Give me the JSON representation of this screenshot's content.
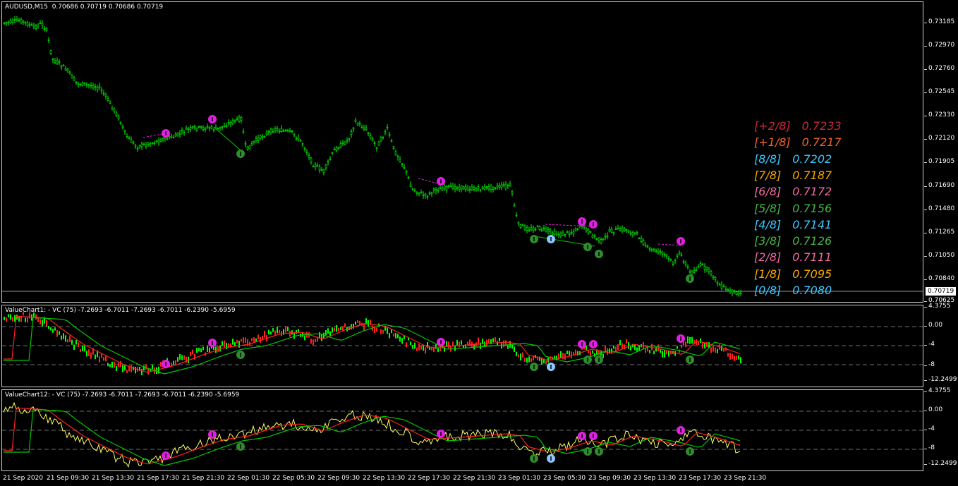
{
  "main": {
    "title": "AUDUSD,M15  0.70686 0.70719 0.70686 0.70719",
    "current_price": "0.70719",
    "price_ticks": [
      "0.73185",
      "0.72970",
      "0.72760",
      "0.72545",
      "0.72330",
      "0.72120",
      "0.71905",
      "0.71690",
      "0.71480",
      "0.71265",
      "0.71050",
      "0.70840",
      "0.70625"
    ],
    "murrey_levels": [
      {
        "label": "[+2/8]",
        "value": "0.7233",
        "color": "#c8283c"
      },
      {
        "label": "[+1/8]",
        "value": "0.7217",
        "color": "#f06428"
      },
      {
        "label": "[8/8]",
        "value": "0.7202",
        "color": "#3cc8ff"
      },
      {
        "label": "[7/8]",
        "value": "0.7187",
        "color": "#f5a800"
      },
      {
        "label": "[6/8]",
        "value": "0.7172",
        "color": "#f06aa0"
      },
      {
        "label": "[5/8]",
        "value": "0.7156",
        "color": "#46b446"
      },
      {
        "label": "[4/8]",
        "value": "0.7141",
        "color": "#3cc8ff"
      },
      {
        "label": "[3/8]",
        "value": "0.7126",
        "color": "#46b446"
      },
      {
        "label": "[2/8]",
        "value": "0.7111",
        "color": "#f06aa0"
      },
      {
        "label": "[1/8]",
        "value": "0.7095",
        "color": "#f5a800"
      },
      {
        "label": "[0/8]",
        "value": "0.7080",
        "color": "#3cc8ff"
      }
    ]
  },
  "vc1": {
    "title": "ValueChart1: - VC (75) -7.2693 -6.7011 -7.2693 -6.7011 -6.2390 -5.6959",
    "ticks": [
      "4.3755",
      "0.00",
      "-4",
      "-8",
      "-12.2499"
    ]
  },
  "vc2": {
    "title": "ValueChart12: - VC (75) -7.2693 -6.7011 -7.2693 -6.7011 -6.2390 -5.6959",
    "ticks": [
      "4.3755",
      "0.00",
      "-4",
      "-8",
      "-12.2499"
    ]
  },
  "time_ticks": [
    "21 Sep 2020",
    "21 Sep 09:30",
    "21 Sep 13:30",
    "21 Sep 17:30",
    "21 Sep 21:30",
    "22 Sep 01:30",
    "22 Sep 05:30",
    "22 Sep 09:30",
    "22 Sep 13:30",
    "22 Sep 17:30",
    "22 Sep 21:30",
    "23 Sep 01:30",
    "23 Sep 05:30",
    "23 Sep 09:30",
    "23 Sep 13:30",
    "23 Sep 17:30",
    "23 Sep 21:30"
  ],
  "colors": {
    "bull": "#00ff00",
    "bear": "#ff2020",
    "ma_red": "#ff2020",
    "ma_green": "#00c800",
    "vc_line": "#ffff66",
    "signal_up": "#2e8b2e",
    "signal_down": "#e020e0",
    "signal_blue": "#8cc8ff"
  }
}
